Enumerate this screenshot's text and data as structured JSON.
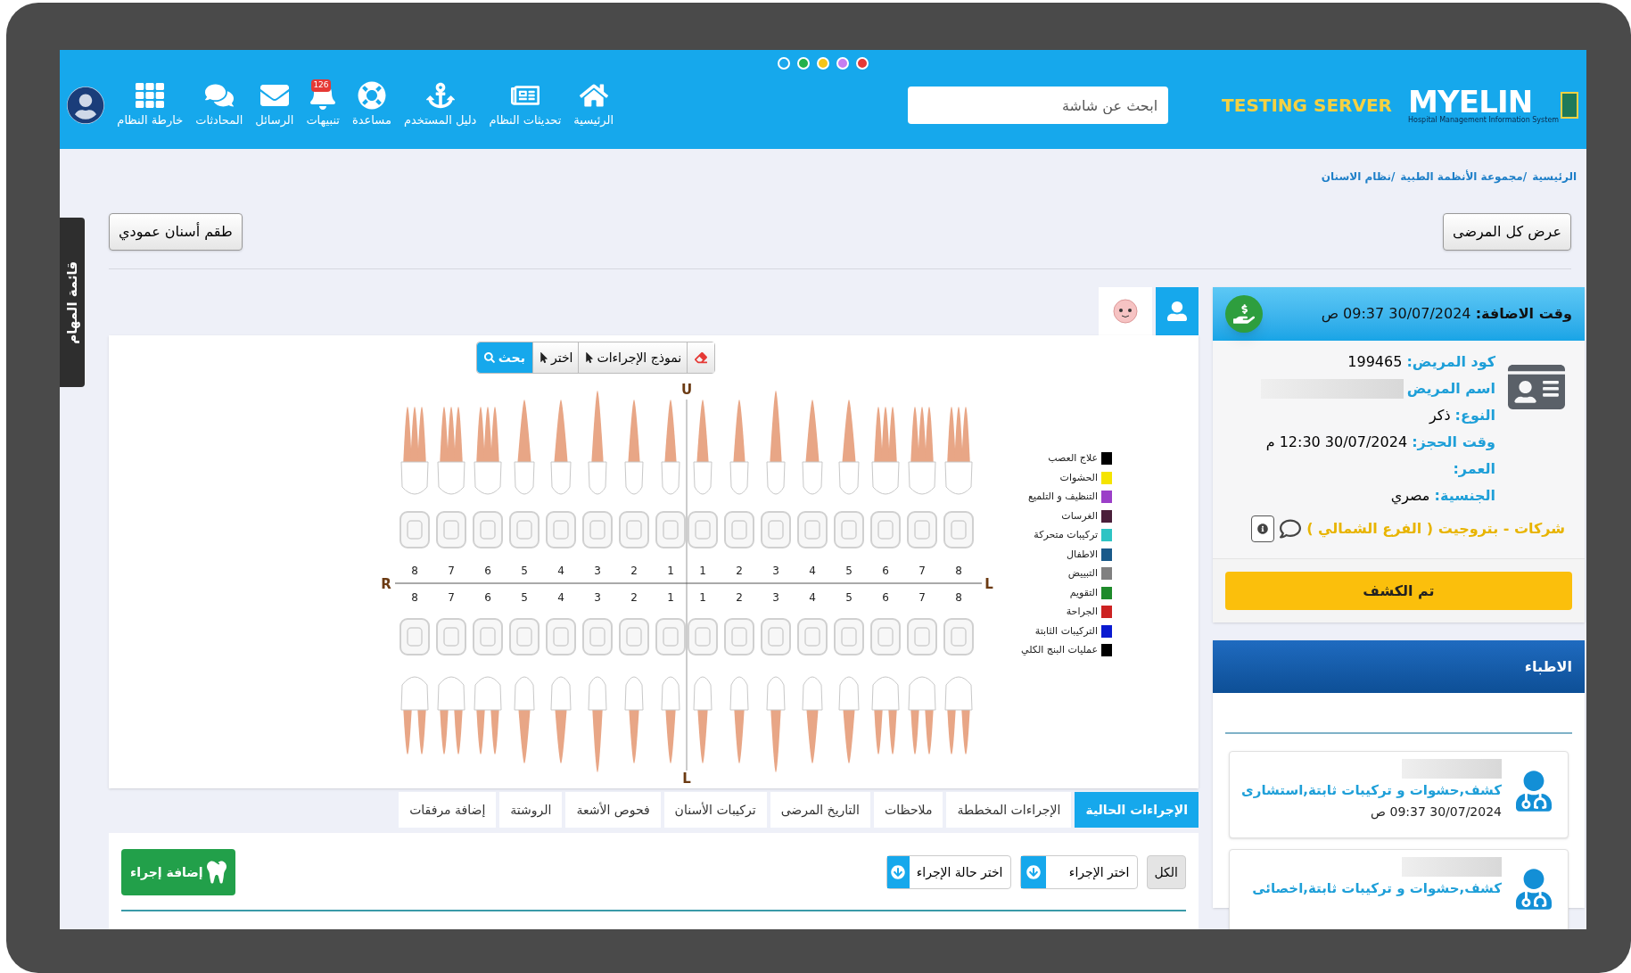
{
  "theme_dots": [
    {
      "color": "#1aa7ec"
    },
    {
      "color": "#22b14c"
    },
    {
      "color": "#f5c518"
    },
    {
      "color": "#c47ef0"
    },
    {
      "color": "#e53935"
    }
  ],
  "logo": {
    "name": "MYELIN",
    "subtitle": "Hospital Management Information System"
  },
  "server_label": "TESTING SERVER",
  "search": {
    "placeholder": "ابحث عن شاشة"
  },
  "nav": [
    {
      "label": "الرئيسية"
    },
    {
      "label": "تحديثات النظام"
    },
    {
      "label": "دليل المستخدم"
    },
    {
      "label": "مساعدة"
    },
    {
      "label": "تنبيهات",
      "badge": "126"
    },
    {
      "label": "الرسائل"
    },
    {
      "label": "المحادثات"
    },
    {
      "label": "خارطة النظام"
    }
  ],
  "side_tab": "قائمة المهام",
  "breadcrumb": [
    "الرئيسية",
    "/مجموعة الأنظمة الطبية",
    "/نظام الاسنان"
  ],
  "buttons": {
    "all_patients": "عرض كل المرضى",
    "vertical_teeth": "طقم أسنان عمودي"
  },
  "patient": {
    "added_label": "وقت الاضافة:",
    "added_value": "30/07/2024 09:37 ص",
    "fields": [
      {
        "kind": "text",
        "label": "كود المريض:",
        "value": "199465"
      },
      {
        "kind": "blurred",
        "label": "اسم المريض"
      },
      {
        "kind": "text",
        "label": "النوع:",
        "value": "ذكر"
      },
      {
        "kind": "text",
        "label": "وقت الحجز:",
        "value": "30/07/2024 12:30 م"
      },
      {
        "kind": "text",
        "label": "العمر:"
      },
      {
        "kind": "text",
        "label": "الجنسية:",
        "value": "مصري"
      }
    ],
    "company": "شركات - بتروجيت ( الفرع الشمالي )",
    "examined_button": "تم الكشف"
  },
  "doctors": {
    "title": "الاطباء",
    "items": [
      {
        "specialty": "كشف,حشوات و تركيبات ثابتة,استشارى",
        "date": "30/07/2024 09:37 ص"
      },
      {
        "specialty": "كشف,حشوات و تركيبات ثابتة,اخصائى"
      }
    ]
  },
  "chart_toolbar": [
    {
      "kind": "eraser"
    },
    {
      "kind": "dropdown",
      "label": "نموذج الإجراءات"
    },
    {
      "kind": "dropdown",
      "label": "اختر"
    },
    {
      "kind": "search",
      "label": "بحث"
    }
  ],
  "dental_chart": {
    "top_label": "U",
    "bottom_label": "L",
    "left_label": "R",
    "right_label": "L",
    "upper_numbers": [
      "8",
      "7",
      "6",
      "5",
      "4",
      "3",
      "2",
      "1",
      "1",
      "2",
      "3",
      "4",
      "5",
      "6",
      "7",
      "8"
    ],
    "lower_numbers": [
      "8",
      "7",
      "6",
      "5",
      "4",
      "3",
      "2",
      "1",
      "1",
      "2",
      "3",
      "4",
      "5",
      "6",
      "7",
      "8"
    ]
  },
  "legend": [
    {
      "label": "علاج العصب",
      "color": "#000000"
    },
    {
      "label": "الحشوات",
      "color": "#f5e400"
    },
    {
      "label": "التنظيف و التلميع",
      "color": "#9b3fc8"
    },
    {
      "label": "الغرسات",
      "color": "#4a1f3a"
    },
    {
      "label": "تركيبات متحركة",
      "color": "#2ec4c4"
    },
    {
      "label": "الاطفال",
      "color": "#1a5a8a"
    },
    {
      "label": "التبييض",
      "color": "#808080"
    },
    {
      "label": "التقويم",
      "color": "#1e8a2a"
    },
    {
      "label": "الجراحة",
      "color": "#cc2222"
    },
    {
      "label": "التركيبات الثابتة",
      "color": "#0a1ad0"
    },
    {
      "label": "عمليات البنج الكلي",
      "color": "#000000"
    }
  ],
  "tabs": [
    {
      "label": "الإجراءات الحالية",
      "selected": true
    },
    {
      "label": "الإجراءات المخططة",
      "selected": false
    },
    {
      "label": "ملاحظات",
      "selected": false
    },
    {
      "label": "التاريخ المرضى",
      "selected": false
    },
    {
      "label": "تركيبات الأسنان",
      "selected": false
    },
    {
      "label": "فحوص الأشعة",
      "selected": false
    },
    {
      "label": "الروشتة",
      "selected": false
    },
    {
      "label": "إضافة مرفقات",
      "selected": false
    }
  ],
  "filters": {
    "all": "الكل",
    "procedure": "اختر الإجراء",
    "status": "اختر حالة الإجراء"
  },
  "add_button": "إضافة إجراء"
}
